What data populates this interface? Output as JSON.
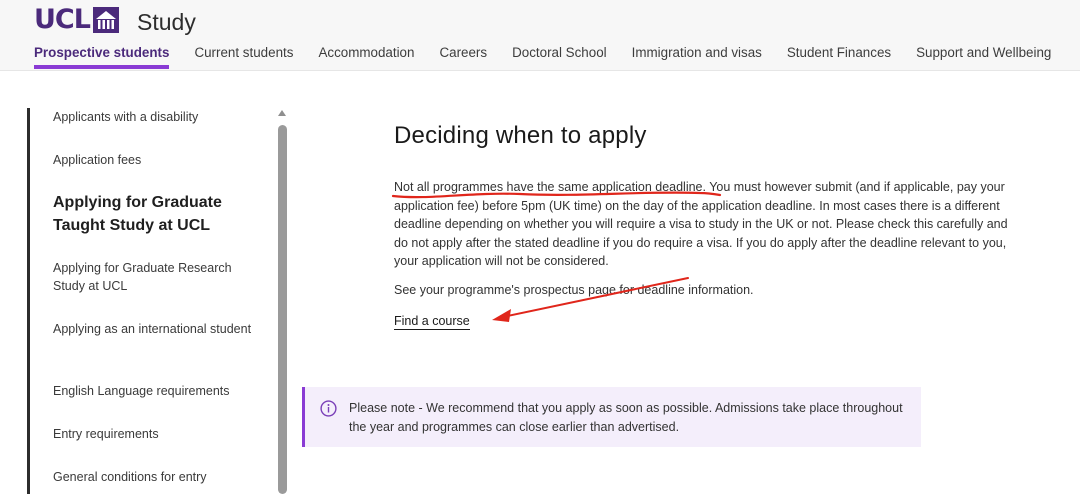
{
  "header": {
    "logo_text": "UCL",
    "site_name": "Study",
    "nav": [
      {
        "label": "Prospective students",
        "active": true
      },
      {
        "label": "Current students",
        "active": false
      },
      {
        "label": "Accommodation",
        "active": false
      },
      {
        "label": "Careers",
        "active": false
      },
      {
        "label": "Doctoral School",
        "active": false
      },
      {
        "label": "Immigration and visas",
        "active": false
      },
      {
        "label": "Student Finances",
        "active": false
      },
      {
        "label": "Support and Wellbeing",
        "active": false
      }
    ]
  },
  "sidebar": {
    "items": [
      {
        "label": "Applicants with a disability"
      },
      {
        "label": "Application fees"
      },
      {
        "label": "Applying for Graduate Taught Study at UCL",
        "current": true
      },
      {
        "label": "Applying for Graduate Research Study at UCL"
      },
      {
        "label": "Applying as an international student"
      },
      {
        "label": "English Language requirements"
      },
      {
        "label": "Entry requirements"
      },
      {
        "label": "General conditions for entry"
      }
    ]
  },
  "main": {
    "heading": "Deciding when to apply",
    "paragraph_highlight": "Not all programmes have the same application deadline.",
    "paragraph_rest": " You must however submit (and if applicable, pay your application fee) before 5pm (UK time) on the day of the application deadline. In most cases there is a different deadline depending on whether you will require a visa to study in the UK or not. Please check this carefully and do not apply after the stated deadline if you do require a visa. If you do apply after the deadline relevant to you, your application will not be considered.",
    "paragraph2": "See your programme's prospectus page for deadline information.",
    "link": "Find a course",
    "note": "Please note - We recommend that you apply as soon as possible. Admissions take place throughout the year and programmes can close earlier than advertised."
  },
  "colors": {
    "brand": "#4b2a7b",
    "accent": "#8a3bd4",
    "note_bg": "#f4eefb",
    "annotation": "#e0261b"
  },
  "icons": [
    "ucl-portico-logo-icon",
    "info-circle-icon",
    "scroll-up-arrow-icon"
  ]
}
